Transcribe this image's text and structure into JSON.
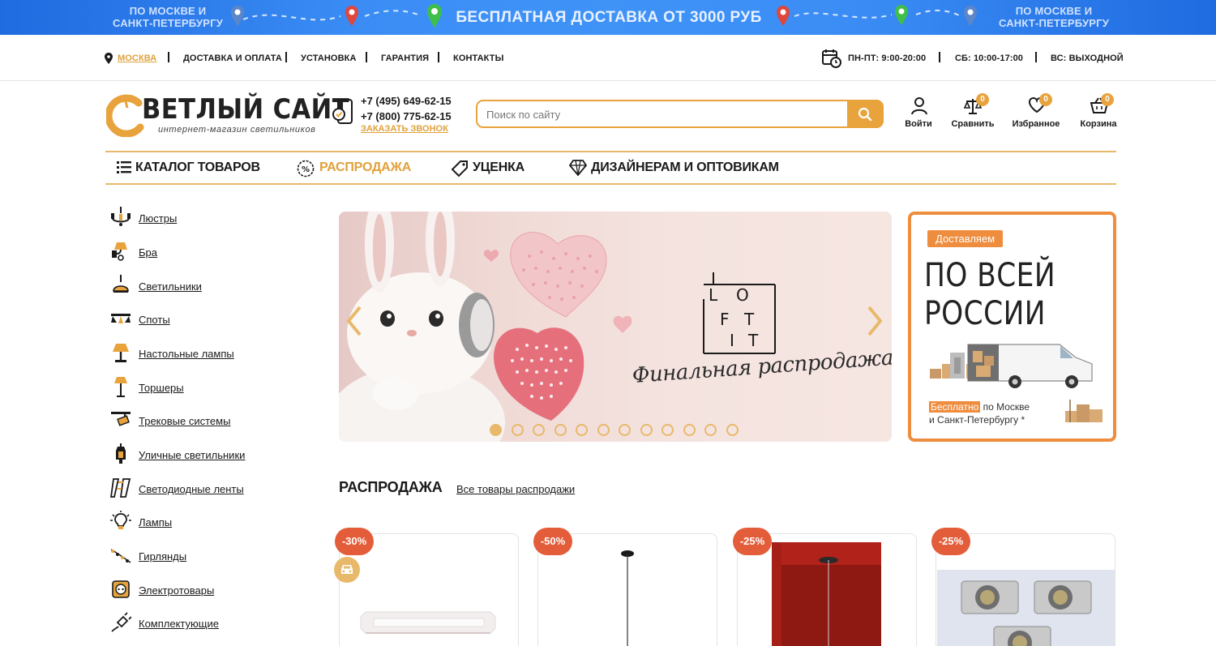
{
  "promo": {
    "city_left": "ПО МОСКВЕ И САНКТ-ПЕТЕРБУРГУ",
    "headline": "БЕСПЛАТНАЯ ДОСТАВКА ОТ 3000 РУБ",
    "city_right": "ПО МОСКВЕ И САНКТ-ПЕТЕРБУРГУ"
  },
  "utility": {
    "city": "МОСКВА",
    "links": [
      "ДОСТАВКА И ОПЛАТА",
      "УСТАНОВКА",
      "ГАРАНТИЯ",
      "КОНТАКТЫ"
    ],
    "hours": [
      "ПН-ПТ: 9:00-20:00",
      "СБ: 10:00-17:00",
      "ВС: ВЫХОДНОЙ"
    ]
  },
  "header": {
    "logo_title": "ВЕТЛЫЙ САЙТ",
    "logo_subtitle": "интернет-магазин светильников",
    "phone1": "+7 (495) 649-62-15",
    "phone2": "+7 (800) 775-62-15",
    "callback": "ЗАКАЗАТЬ ЗВОНОК",
    "search_placeholder": "Поиск по сайту",
    "actions": {
      "login": "Войти",
      "compare": "Сравнить",
      "compare_count": "0",
      "favorites": "Избранное",
      "favorites_count": "0",
      "cart": "Корзина",
      "cart_count": "0"
    }
  },
  "nav": {
    "catalog": "КАТАЛОГ ТОВАРОВ",
    "sale": "РАСПРОДАЖА",
    "discount": "УЦЕНКА",
    "designers": "ДИЗАЙНЕРАМ И ОПТОВИКАМ"
  },
  "sidebar": {
    "items": [
      {
        "label": "Люстры",
        "icon": "chandelier-icon"
      },
      {
        "label": "Бра",
        "icon": "sconce-icon"
      },
      {
        "label": "Светильники",
        "icon": "pendant-lamp-icon"
      },
      {
        "label": "Споты",
        "icon": "spot-light-icon"
      },
      {
        "label": "Настольные лампы",
        "icon": "table-lamp-icon"
      },
      {
        "label": "Торшеры",
        "icon": "floor-lamp-icon"
      },
      {
        "label": "Трековые системы",
        "icon": "track-light-icon"
      },
      {
        "label": "Уличные светильники",
        "icon": "street-lamp-icon"
      },
      {
        "label": "Светодиодные ленты",
        "icon": "led-strip-icon"
      },
      {
        "label": "Лампы",
        "icon": "bulb-icon"
      },
      {
        "label": "Гирлянды",
        "icon": "garland-icon"
      },
      {
        "label": "Электротовары",
        "icon": "socket-icon"
      },
      {
        "label": "Комплектующие",
        "icon": "plug-icon"
      }
    ]
  },
  "hero": {
    "brand": "LOFT IT",
    "subtitle": "Финальная распродажа",
    "slide_count": 12,
    "active_slide": 1
  },
  "delivery_promo": {
    "tag": "Доставляем",
    "headline_line1": "ПО ВСЕЙ",
    "headline_line2": "РОССИИ",
    "free_highlight": "Бесплатно",
    "free_text1": " по Москве",
    "free_text2": "и Санкт-Петербургу *"
  },
  "sale_section": {
    "title": "РАСПРОДАЖА",
    "all_link": "Все товары распродажи",
    "products": [
      {
        "discount": "-30%",
        "has_delivery_badge": true
      },
      {
        "discount": "-50%",
        "has_delivery_badge": false
      },
      {
        "discount": "-25%",
        "has_delivery_badge": false
      },
      {
        "discount": "-25%",
        "has_delivery_badge": false
      }
    ]
  },
  "colors": {
    "accent": "#e8a33d",
    "sale_badge": "#e35d3a",
    "promo_blue": "#3b8df5"
  }
}
